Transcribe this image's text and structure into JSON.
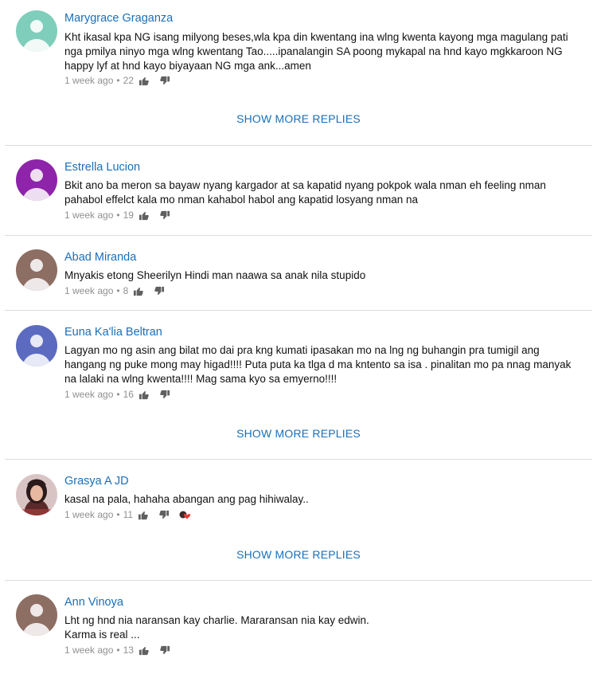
{
  "comments": [
    {
      "author": "Marygrace Graganza",
      "avatar_color": "#7fcdbb",
      "text": "Kht ikasal kpa NG isang milyong beses,wla kpa din kwentang ina wlng kwenta kayong mga magulang pati nga pmilya ninyo mga wlng kwentang Tao.....ipanalangin SA poong mykapal na hnd kayo mgkkaroon NG happy lyf at hnd kayo biyayaan NG mga ank...amen",
      "time": "1 week ago",
      "likes": "22",
      "show_more": "SHOW MORE REPLIES"
    },
    {
      "author": "Estrella Lucion",
      "avatar_color": "#8e24aa",
      "text": "Bkit ano ba meron sa bayaw nyang kargador at sa kapatid nyang pokpok wala nman eh feeling nman pahabol effelct   kala mo nman kahabol habol ang kapatid losyang nman na",
      "time": "1 week ago",
      "likes": "19"
    },
    {
      "author": "Abad Miranda",
      "avatar_color": "#8d6e63",
      "text": "Mnyakis etong Sheerilyn Hindi man naawa sa anak nila stupido",
      "time": "1 week ago",
      "likes": "8"
    },
    {
      "author": "Euna Ka'lia Beltran",
      "avatar_color": "#5c6bc0",
      "text": "Lagyan mo ng asin ang bilat mo dai pra kng kumati ipasakan mo na lng ng buhangin pra tumigil ang hangang ng puke mong may  higad!!!! Puta puta ka tlga d ma kntento sa isa . pinalitan mo pa nnag manyak na lalaki na  wlng kwenta!!!! Mag sama kyo sa emyerno!!!!",
      "time": "1 week ago",
      "likes": "16",
      "show_more": "SHOW MORE REPLIES"
    },
    {
      "author": "Grasya A JD",
      "avatar_color": "#5a2a2a",
      "text": "kasal na pala, hahaha abangan ang pag hihiwalay..",
      "time": "1 week ago",
      "likes": "11",
      "show_more": "SHOW MORE REPLIES"
    },
    {
      "author": "Ann Vinoya",
      "avatar_color": "#8d6e63",
      "text": "Lht ng hnd nia naransan kay charlie. Mararansan nia kay edwin.\n Karma is real ...",
      "time": "1 week ago",
      "likes": "13"
    }
  ],
  "icons": {
    "like": "thumb-up-icon",
    "dislike": "thumb-down-icon",
    "creator_heart": "creator-heart-icon"
  },
  "colors": {
    "link": "#1a6fb8",
    "meta": "#909090",
    "divider": "#dcdcdc"
  }
}
